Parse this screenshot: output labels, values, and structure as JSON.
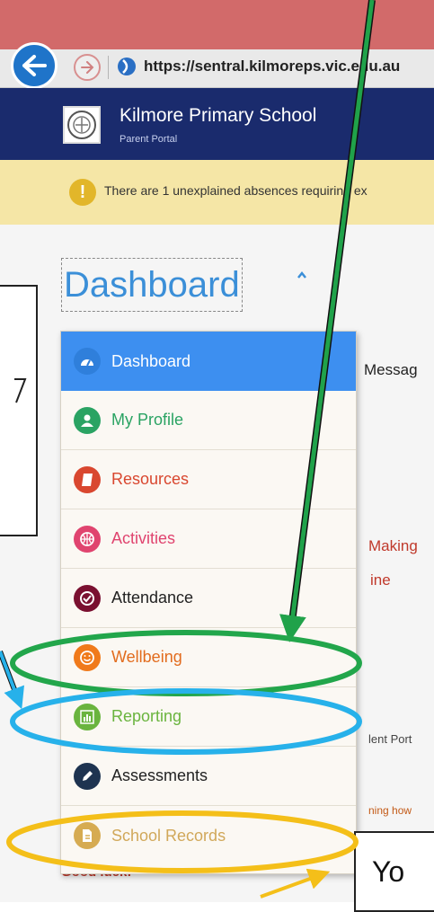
{
  "browser": {
    "url": "https://sentral.kilmoreps.vic.edu.au"
  },
  "school": {
    "name": "Kilmore Primary School",
    "portal": "Parent Portal"
  },
  "alert": {
    "text": "There are 1 unexplained absences requiring ex"
  },
  "page": {
    "title": "Dashboard",
    "peek": {
      "messages": "Messag",
      "making": "Making",
      "line": "ine",
      "student_portal": "lent Port",
      "ng": "ng",
      "partial_link": "ning how"
    },
    "good_luck": "Good luck!"
  },
  "menu": {
    "items": [
      {
        "label": "Dashboard",
        "color": "#ffffff",
        "icon_bg": "#2f7fdb",
        "icon": "dashboard-icon"
      },
      {
        "label": "My Profile",
        "color": "#2aa363",
        "icon_bg": "#2aa363",
        "icon": "user-icon"
      },
      {
        "label": "Resources",
        "color": "#d9472f",
        "icon_bg": "#d9472f",
        "icon": "book-icon"
      },
      {
        "label": "Activities",
        "color": "#e0446f",
        "icon_bg": "#e0446f",
        "icon": "basketball-icon"
      },
      {
        "label": "Attendance",
        "color": "#222222",
        "icon_bg": "#7a1030",
        "icon": "check-icon"
      },
      {
        "label": "Wellbeing",
        "color": "#e26c1e",
        "icon_bg": "#f07a1b",
        "icon": "smile-icon"
      },
      {
        "label": "Reporting",
        "color": "#6ab43e",
        "icon_bg": "#6ab43e",
        "icon": "bar-chart-icon"
      },
      {
        "label": "Assessments",
        "color": "#222222",
        "icon_bg": "#1e3350",
        "icon": "pencil-icon"
      },
      {
        "label": "School Records",
        "color": "#d1a85a",
        "icon_bg": "#d6ab52",
        "icon": "document-icon"
      }
    ]
  },
  "annotation": {
    "box_text": "Yo"
  },
  "colors": {
    "arrow_green": "#20a24a",
    "ellipse_green": "#22a64b",
    "ellipse_blue": "#27b1ea",
    "ellipse_yellow": "#f4bf19"
  }
}
